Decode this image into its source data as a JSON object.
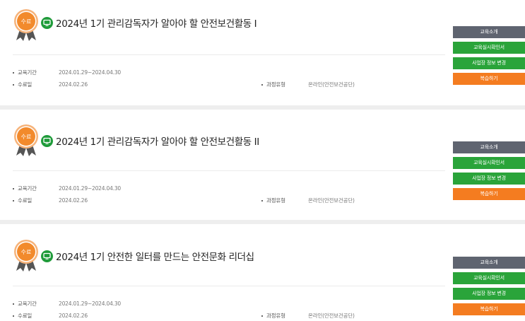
{
  "labels": {
    "period": "교육기간",
    "completed": "수료일",
    "course_type": "과정유형"
  },
  "badge_text": "수료",
  "buttons": {
    "intro": "교육소개",
    "certificate": "교육실시확인서",
    "change_workplace": "사업장 정보 변경",
    "review": "복습하기"
  },
  "courses": [
    {
      "title": "2024년 1기 관리감독자가 알아야 할 안전보건활동 I",
      "period": "2024.01.29~2024.04.30",
      "completed_date": "2024.02.26",
      "course_type": "온라인(안전보건공단)"
    },
    {
      "title": "2024년 1기 관리감독자가 알아야 할 안전보건활동 II",
      "period": "2024.01.29~2024.04.30",
      "completed_date": "2024.02.26",
      "course_type": "온라인(안전보건공단)"
    },
    {
      "title": "2024년 1기 안전한 일터를 만드는 안전문화 리더십",
      "period": "2024.01.29~2024.04.30",
      "completed_date": "2024.02.26",
      "course_type": "온라인(안전보건공단)"
    }
  ],
  "colors": {
    "badge_orange": "#f28a2c",
    "ribbon_gray": "#5a5a5a",
    "icon_green": "#1f9b3a",
    "btn_gray": "#5f6470",
    "btn_green": "#2aa43a",
    "btn_orange": "#f47c20"
  }
}
